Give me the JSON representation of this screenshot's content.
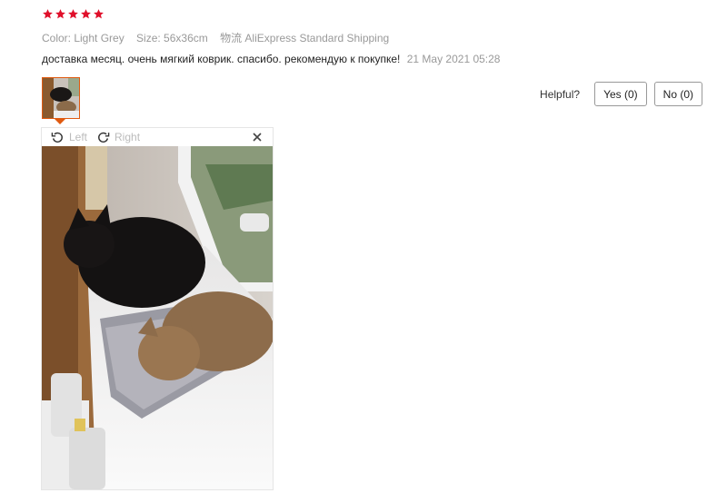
{
  "review": {
    "rating": 5,
    "star_color": "#e0102b",
    "meta": {
      "color": "Color: Light Grey",
      "size": "Size: 56x36cm",
      "shipping": "物流 AliExpress Standard Shipping"
    },
    "text": "доставка месяц. очень мягкий коврик. спасибо. рекомендую к покупке!",
    "date": "21 May 2021 05:28"
  },
  "helpful": {
    "label": "Helpful?",
    "yes": "Yes (0)",
    "no": "No (0)"
  },
  "viewer": {
    "rotate_left": "Left",
    "rotate_right": "Right"
  },
  "icons": {
    "rotate_left": "rotate-left-icon",
    "rotate_right": "rotate-right-icon",
    "close": "close-icon"
  },
  "accent_color": "#e05a10"
}
